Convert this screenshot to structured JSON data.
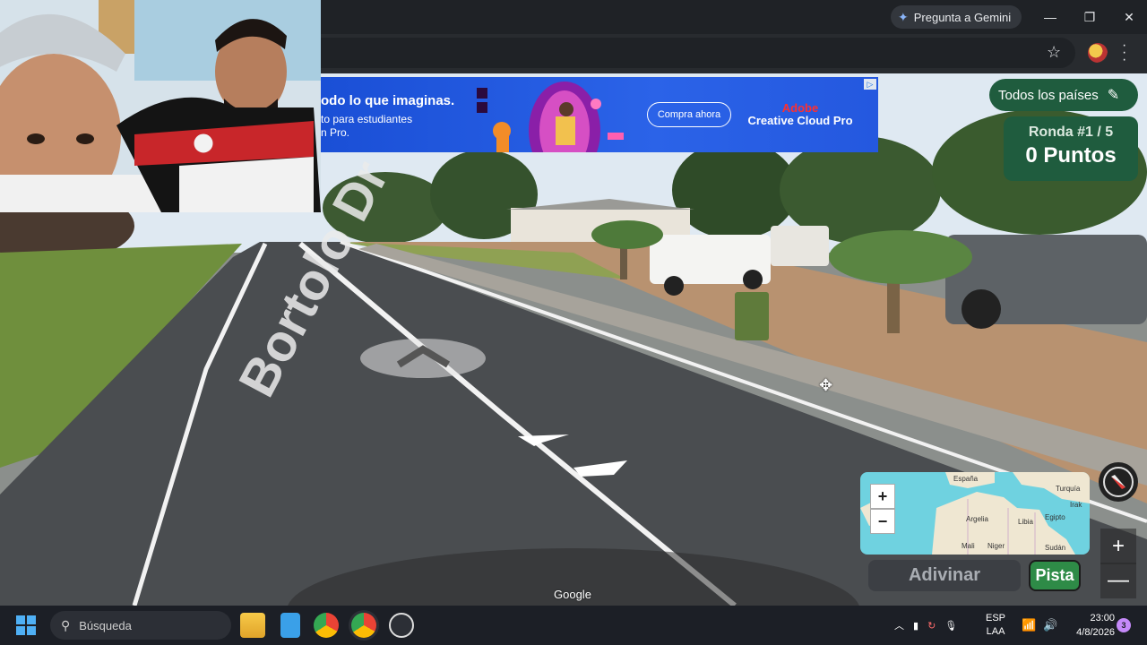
{
  "browser": {
    "gemini_label": "Pregunta a Gemini",
    "icons": [
      "minimize-icon",
      "maximize-icon",
      "close-icon",
      "bookmark-star-icon",
      "menu-kebab-icon"
    ]
  },
  "ad": {
    "headline": "odo lo que imaginas.",
    "subline1": "to para estudiantes",
    "subline2": "n Pro.",
    "cta": "Compra ahora",
    "brand_top": "Adobe",
    "brand_bottom": "Creative Cloud Pro",
    "brand_color": "#ff2f2f"
  },
  "street": {
    "street_name": "Bortolo Dr",
    "google_label": "Google"
  },
  "game": {
    "countries_label": "Todos los países",
    "round_label": "Ronda #1 / 5",
    "points_label": "0 Puntos",
    "guess_label": "Adivinar",
    "hint_label": "Pista",
    "map_zoom_in": "+",
    "map_zoom_out": "−",
    "view_zoom_in": "+",
    "view_zoom_out": "—",
    "map_labels": [
      "España",
      "Turquía",
      "Argelia",
      "Libia",
      "Egipto",
      "Irak",
      "Mali",
      "Niger",
      "Sudán"
    ],
    "accent_color": "#1f5c3e",
    "hint_color": "#2e8b47"
  },
  "taskbar": {
    "search_label": "Búsqueda",
    "lang_top": "ESP",
    "lang_bottom": "LAA",
    "time": "23:00",
    "date": "4/8/2026",
    "notification_count": "3"
  }
}
